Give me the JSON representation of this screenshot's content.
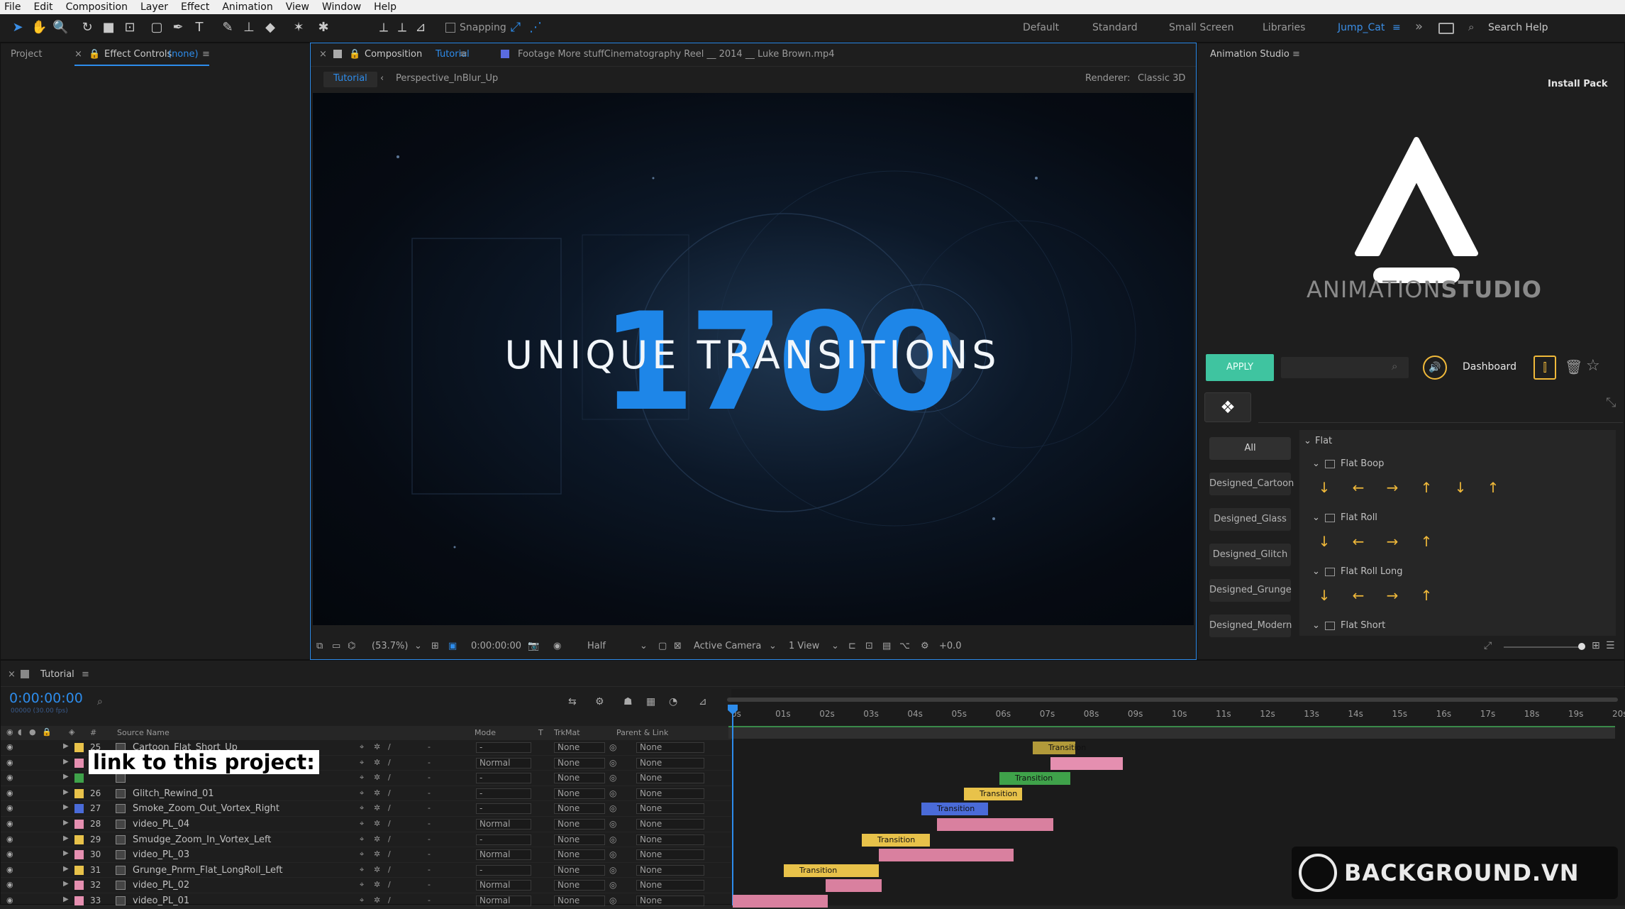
{
  "menu": [
    "File",
    "Edit",
    "Composition",
    "Layer",
    "Effect",
    "Animation",
    "View",
    "Window",
    "Help"
  ],
  "toolbar": {
    "snapping_label": "Snapping",
    "workspaces": [
      "Default",
      "Standard",
      "Small Screen",
      "Libraries",
      "Jump_Cat"
    ],
    "active_workspace": "Jump_Cat",
    "search_placeholder": "Search Help"
  },
  "project_panel": {
    "tab_project": "Project",
    "tab_effect_prefix": "Effect Controls",
    "tab_effect_suffix": "(none)"
  },
  "comp_panel": {
    "tab_comp_prefix": "Composition",
    "tab_comp_name": "Tutorial",
    "tab_footage": "Footage More stuffCinematography Reel __ 2014 __ Luke Brown.mp4",
    "breadcrumb_active": "Tutorial",
    "breadcrumb_next": "Perspective_InBlur_Up",
    "renderer_label": "Renderer:",
    "renderer_value": "Classic 3D",
    "viewer_number": "1700",
    "viewer_title": "UNIQUE TRANSITIONS",
    "zoom": "(53.7%)",
    "timecode": "0:00:00:00",
    "resolution": "Half",
    "camera": "Active Camera",
    "view_count": "1 View",
    "exposure": "+0.0"
  },
  "studio_panel": {
    "title": "Animation Studio",
    "install_pack": "Install Pack",
    "logo_text_a": "ANIMATION",
    "logo_text_b": "STUDIO",
    "apply": "APPLY",
    "dashboard": "Dashboard",
    "categories": [
      "All",
      "Designed_Cartoon",
      "Designed_Glass",
      "Designed_Glitch",
      "Designed_Grunge",
      "Designed_Modern"
    ],
    "tree_root": "Flat",
    "groups": [
      "Flat Boop",
      "Flat Roll",
      "Flat Roll Long",
      "Flat Short"
    ],
    "arrow_icons": {
      "flat_boop": [
        "↓",
        "←",
        "→",
        "↑",
        "↓",
        "↑"
      ],
      "flat_roll": [
        "↓",
        "←",
        "→",
        "↑"
      ],
      "flat_roll_long": [
        "↓",
        "←",
        "→",
        "↑"
      ]
    },
    "accent": "#3fc4a0",
    "icon_color": "#f0b93a"
  },
  "timeline": {
    "tab": "Tutorial",
    "timecode": "0:00:00:00",
    "timecode_sub": "00000 (30.00 fps)",
    "col_source": "Source Name",
    "col_mode": "Mode",
    "col_t": "T",
    "col_trkmat": "TrkMat",
    "col_parent": "Parent & Link",
    "ruler": [
      "0s",
      "01s",
      "02s",
      "03s",
      "04s",
      "05s",
      "06s",
      "07s",
      "08s",
      "09s",
      "10s",
      "11s",
      "12s",
      "13s",
      "14s",
      "15s",
      "16s",
      "17s",
      "18s",
      "19s",
      "20s"
    ],
    "layers": [
      {
        "num": "25",
        "name": "Cartoon_Flat_Short_Up",
        "mode": "-",
        "trk": "None",
        "parent": "None",
        "color": "#e8c24a"
      },
      {
        "num": "",
        "name": "",
        "mode": "Normal",
        "trk": "None",
        "parent": "None",
        "color": "#e58fb0"
      },
      {
        "num": "",
        "name": "",
        "mode": "-",
        "trk": "None",
        "parent": "None",
        "color": "#3fa24a"
      },
      {
        "num": "26",
        "name": "Glitch_Rewind_01",
        "mode": "-",
        "trk": "None",
        "parent": "None",
        "color": "#e8c24a"
      },
      {
        "num": "27",
        "name": "Smoke_Zoom_Out_Vortex_Right",
        "mode": "-",
        "trk": "None",
        "parent": "None",
        "color": "#4a6bd8"
      },
      {
        "num": "28",
        "name": "video_PL_04",
        "mode": "Normal",
        "trk": "None",
        "parent": "None",
        "color": "#e58fb0"
      },
      {
        "num": "29",
        "name": "Smudge_Zoom_In_Vortex_Left",
        "mode": "-",
        "trk": "None",
        "parent": "None",
        "color": "#e8c24a"
      },
      {
        "num": "30",
        "name": "video_PL_03",
        "mode": "Normal",
        "trk": "None",
        "parent": "None",
        "color": "#e58fb0"
      },
      {
        "num": "31",
        "name": "Grunge_Pnrm_Flat_LongRoll_Left",
        "mode": "-",
        "trk": "None",
        "parent": "None",
        "color": "#e8c24a"
      },
      {
        "num": "32",
        "name": "video_PL_02",
        "mode": "Normal",
        "trk": "None",
        "parent": "None",
        "color": "#e58fb0"
      },
      {
        "num": "33",
        "name": "video_PL_01",
        "mode": "Normal",
        "trk": "None",
        "parent": "None",
        "color": "#e58fb0"
      }
    ],
    "clip_label": "Transition",
    "overlay_text": "link to this project:"
  },
  "watermark": "BACKGROUND.VN"
}
